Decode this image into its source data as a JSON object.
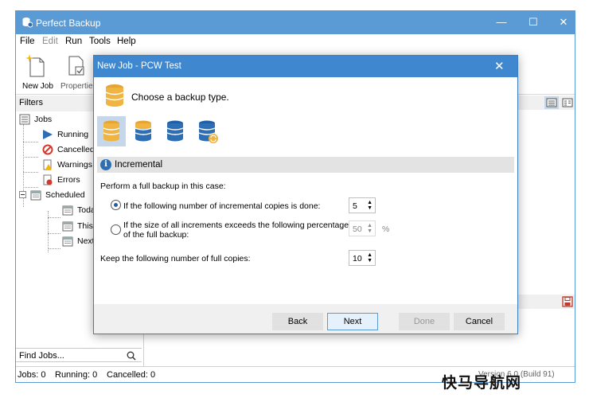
{
  "app": {
    "title": "Perfect Backup",
    "accent": "#5b9bd5"
  },
  "window_controls": {
    "minimize": "—",
    "maximize": "☐",
    "close": "✕"
  },
  "menu": [
    "File",
    "Edit",
    "Run",
    "Tools",
    "Help"
  ],
  "toolbar": {
    "new_job": "New Job",
    "properties": "Properties"
  },
  "filters": {
    "header": "Filters",
    "tree": {
      "jobs": "Jobs",
      "running": "Running",
      "cancelled": "Cancelled",
      "warnings": "Warnings",
      "errors": "Errors",
      "scheduled": "Scheduled",
      "today": "Toda",
      "this": "This",
      "next": "Next"
    }
  },
  "find": {
    "label": "Find Jobs..."
  },
  "status": {
    "jobs": "Jobs: 0",
    "running": "Running: 0",
    "cancelled": "Cancelled: 0",
    "version": "Version 6.0 (Build 91)"
  },
  "dialog": {
    "title": "New Job - PCW Test",
    "close": "✕",
    "heading": "Choose a backup type.",
    "section": "Incremental",
    "perform_label": "Perform a full backup in this case:",
    "option1": "If the following number of incremental copies is done:",
    "option1_value": "5",
    "option2_line1": "If the size of all increments exceeds the following percentage",
    "option2_line2": "of the full backup:",
    "option2_value": "50",
    "percent": "%",
    "keep_label": "Keep the following number of full copies:",
    "keep_value": "10",
    "buttons": {
      "back": "Back",
      "next": "Next",
      "done": "Done",
      "cancel": "Cancel"
    }
  },
  "watermark": "快马导航网"
}
